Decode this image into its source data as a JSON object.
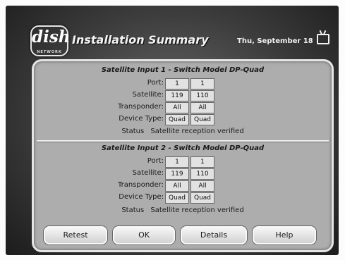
{
  "header": {
    "logo_text": "dish",
    "logo_subtext": "NETWORK",
    "title": "Installation Summary",
    "date": "Thu, September 18",
    "tv_icon": "tv-icon"
  },
  "labels": {
    "port": "Port:",
    "satellite": "Satellite:",
    "transponder": "Transponder:",
    "device_type": "Device Type:",
    "status": "Status"
  },
  "inputs": [
    {
      "title": "Satellite Input 1 - Switch Model DP-Quad",
      "port": [
        "1",
        "1"
      ],
      "satellite": [
        "119",
        "110"
      ],
      "transponder": [
        "All",
        "All"
      ],
      "device_type": [
        "Quad",
        "Quad"
      ],
      "status": "Satellite reception verified"
    },
    {
      "title": "Satellite Input 2 - Switch Model DP-Quad",
      "port": [
        "1",
        "1"
      ],
      "satellite": [
        "119",
        "110"
      ],
      "transponder": [
        "All",
        "All"
      ],
      "device_type": [
        "Quad",
        "Quad"
      ],
      "status": "Satellite reception verified"
    }
  ],
  "buttons": {
    "retest": "Retest",
    "ok": "OK",
    "details": "Details",
    "help": "Help"
  }
}
